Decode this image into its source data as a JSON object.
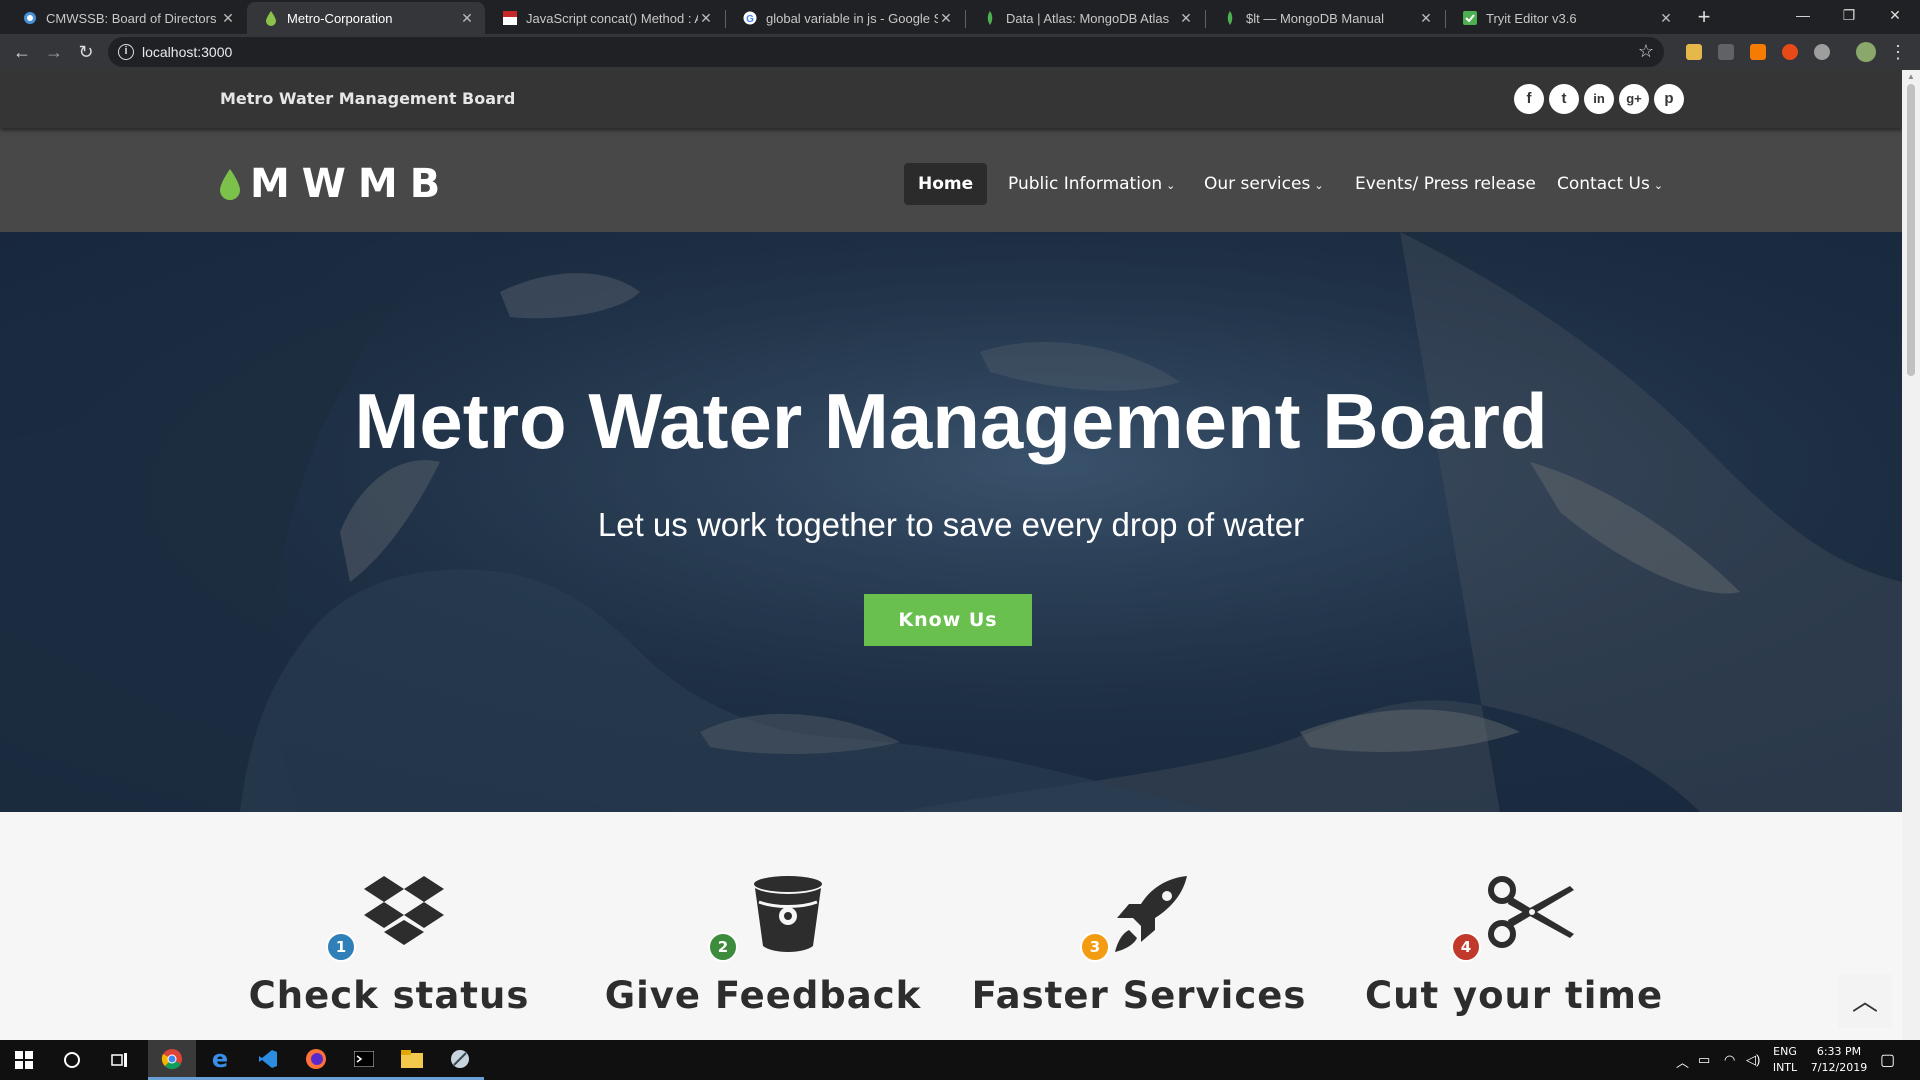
{
  "browser": {
    "tabs": [
      {
        "title": "CMWSSB: Board of Directors",
        "active": false
      },
      {
        "title": "Metro-Corporation",
        "active": true
      },
      {
        "title": "JavaScript concat() Method : Arra",
        "active": false
      },
      {
        "title": "global variable in js - Google Sea",
        "active": false
      },
      {
        "title": "Data | Atlas: MongoDB Atlas",
        "active": false
      },
      {
        "title": "$lt — MongoDB Manual",
        "active": false
      },
      {
        "title": "Tryit Editor v3.6",
        "active": false
      }
    ],
    "url": "localhost:3000",
    "icons": [
      "back-icon",
      "forward-icon",
      "reload-icon",
      "info-icon",
      "star-icon",
      "new-tab-icon",
      "minimize-icon",
      "restore-icon",
      "close-icon"
    ]
  },
  "site": {
    "topbar_title": "Metro Water Management Board",
    "social": [
      {
        "name": "facebook-icon",
        "glyph": "f"
      },
      {
        "name": "twitter-icon",
        "glyph": "t"
      },
      {
        "name": "linkedin-icon",
        "glyph": "in"
      },
      {
        "name": "google-plus-icon",
        "glyph": "g+"
      },
      {
        "name": "pinterest-icon",
        "glyph": "p"
      }
    ],
    "logo_text": "MWMB",
    "nav": [
      {
        "label": "Home",
        "dropdown": false,
        "active": true
      },
      {
        "label": "Public Information",
        "dropdown": true,
        "active": false
      },
      {
        "label": "Our services",
        "dropdown": true,
        "active": false
      },
      {
        "label": "Events/ Press release",
        "dropdown": false,
        "active": false
      },
      {
        "label": "Contact Us",
        "dropdown": true,
        "active": false
      }
    ],
    "hero": {
      "title": "Metro Water Management Board",
      "subtitle": "Let us work together to save every drop of water",
      "button": "Know Us"
    },
    "features": [
      {
        "num": "1",
        "title": "Check status",
        "icon": "dropbox-icon"
      },
      {
        "num": "2",
        "title": "Give Feedback",
        "icon": "bucket-icon"
      },
      {
        "num": "3",
        "title": "Faster Services",
        "icon": "rocket-icon"
      },
      {
        "num": "4",
        "title": "Cut your time",
        "icon": "scissors-icon"
      }
    ]
  },
  "taskbar": {
    "lang": "ENG",
    "layout": "INTL",
    "time": "6:33 PM",
    "date": "7/12/2019"
  },
  "colors": {
    "accent_green": "#6ac04f",
    "feature_badges": [
      "#2f7fb8",
      "#3d8b3d",
      "#f39c12",
      "#c0392b"
    ]
  }
}
